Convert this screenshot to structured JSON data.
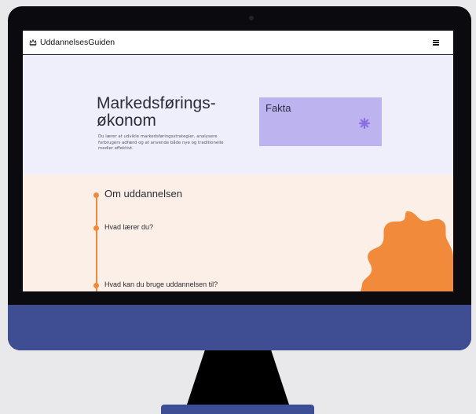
{
  "brand": {
    "name": "UddannelsesGuiden"
  },
  "hero": {
    "breadcrumb": "",
    "title_line1": "Markedsførings-",
    "title_line2": "økonom",
    "lead": "Du lærer at udvikle markedsføringsstrategier, analysere forbrugers adfærd og at anvende både nye og traditionelle medier effektivt."
  },
  "facts": {
    "title": "Fakta",
    "duration_label": "",
    "duration_value": "",
    "location_label": "",
    "location_value": "",
    "internship_label": "",
    "internship_value": ""
  },
  "content": {
    "heading": "Om uddannelsen",
    "intro": "",
    "learn_heading": "Hvad lærer du?",
    "learn_p1": "",
    "learn_p2": "",
    "use_heading": "Hvad kan du bruge uddannelsen til?"
  },
  "colors": {
    "hero_background": "#efeffc",
    "facts_background": "#bdb4ef",
    "accent_orange": "#f08a3a",
    "content_background": "#fcefe7",
    "monitor_chin": "#3f4d92"
  },
  "icons": {
    "brand_logo": "crown-logo-icon",
    "menu": "hamburger-menu-icon",
    "decoration": "asterisk-flower-icon",
    "shape": "orange-sun-blob"
  }
}
